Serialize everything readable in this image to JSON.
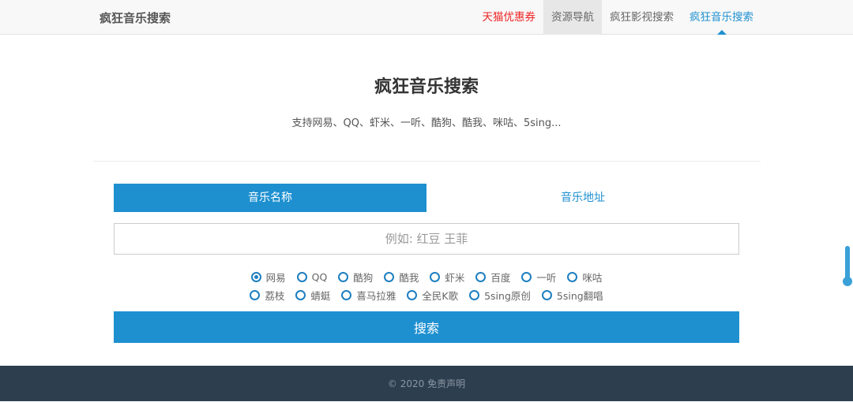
{
  "nav": {
    "brand": "疯狂音乐搜索",
    "items": [
      {
        "label": "天猫优惠券"
      },
      {
        "label": "资源导航"
      },
      {
        "label": "疯狂影视搜索"
      },
      {
        "label": "疯狂音乐搜索"
      }
    ]
  },
  "main": {
    "title": "疯狂音乐搜索",
    "subtitle": "支持网易、QQ、虾米、一听、酷狗、酷我、咪咕、5sing...",
    "tabs": [
      {
        "label": "音乐名称"
      },
      {
        "label": "音乐地址"
      }
    ],
    "search": {
      "placeholder": "例如: 红豆 王菲",
      "value": ""
    },
    "sources_row1": [
      "网易",
      "QQ",
      "酷狗",
      "酷我",
      "虾米",
      "百度",
      "一听",
      "咪咕"
    ],
    "sources_row2": [
      "荔枝",
      "蜻蜓",
      "喜马拉雅",
      "全民K歌",
      "5sing原创",
      "5sing翻唱"
    ],
    "selected_source": "网易",
    "search_button": "搜索"
  },
  "footer": {
    "text": "© 2020 免责声明"
  }
}
